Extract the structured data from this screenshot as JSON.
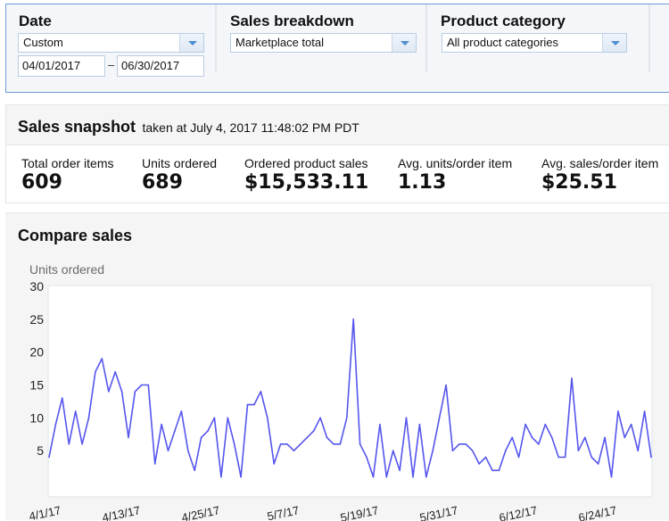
{
  "filters": {
    "date": {
      "label": "Date",
      "selected": "Custom",
      "from": "04/01/2017",
      "to": "06/30/2017",
      "dash": "–"
    },
    "sales_breakdown": {
      "label": "Sales breakdown",
      "selected": "Marketplace total"
    },
    "product_category": {
      "label": "Product category",
      "selected": "All product categories"
    }
  },
  "snapshot": {
    "title": "Sales snapshot",
    "subtitle": "taken at July 4, 2017 11:48:02 PM PDT",
    "metrics": [
      {
        "label": "Total order items",
        "value": "609"
      },
      {
        "label": "Units ordered",
        "value": "689"
      },
      {
        "label": "Ordered product sales",
        "value": "$15,533.11"
      },
      {
        "label": "Avg. units/order item",
        "value": "1.13"
      },
      {
        "label": "Avg. sales/order item",
        "value": "$25.51"
      }
    ]
  },
  "compare": {
    "title": "Compare sales"
  },
  "colors": {
    "line": "#5555ee",
    "filter_border": "#6f9ad6",
    "caret": "#4f8fd0"
  },
  "chart_data": {
    "type": "line",
    "title": "Compare sales",
    "ylabel": "Units ordered",
    "xlabel": "",
    "ylim": [
      0,
      30
    ],
    "yticks": [
      "5",
      "10",
      "15",
      "20",
      "25",
      "30"
    ],
    "ytick_values": [
      5,
      10,
      15,
      20,
      25,
      30
    ],
    "xtick_labels": [
      "4/1/17",
      "4/13/17",
      "4/25/17",
      "5/7/17",
      "5/19/17",
      "5/31/17",
      "6/12/17",
      "6/24/17"
    ],
    "xtick_indices": [
      0,
      12,
      24,
      36,
      48,
      60,
      72,
      84
    ],
    "x_start": "4/1/17",
    "x_end": "6/30/17",
    "series": [
      {
        "name": "Units ordered",
        "values": [
          4,
          9,
          13,
          6,
          11,
          6,
          10,
          17,
          19,
          14,
          17,
          14,
          7,
          14,
          15,
          15,
          3,
          9,
          5,
          8,
          11,
          5,
          2,
          7,
          8,
          10,
          1,
          10,
          6,
          1,
          12,
          12,
          14,
          10,
          3,
          6,
          6,
          5,
          6,
          7,
          8,
          10,
          7,
          6,
          6,
          10,
          25,
          6,
          4,
          1,
          9,
          1,
          5,
          2,
          10,
          1,
          9,
          1,
          5,
          10,
          15,
          5,
          6,
          6,
          5,
          3,
          4,
          2,
          2,
          5,
          7,
          4,
          9,
          7,
          6,
          9,
          7,
          4,
          4,
          16,
          5,
          7,
          4,
          3,
          7,
          1,
          11,
          7,
          9,
          5,
          11,
          4
        ]
      }
    ],
    "grid": false,
    "legend": "none"
  }
}
